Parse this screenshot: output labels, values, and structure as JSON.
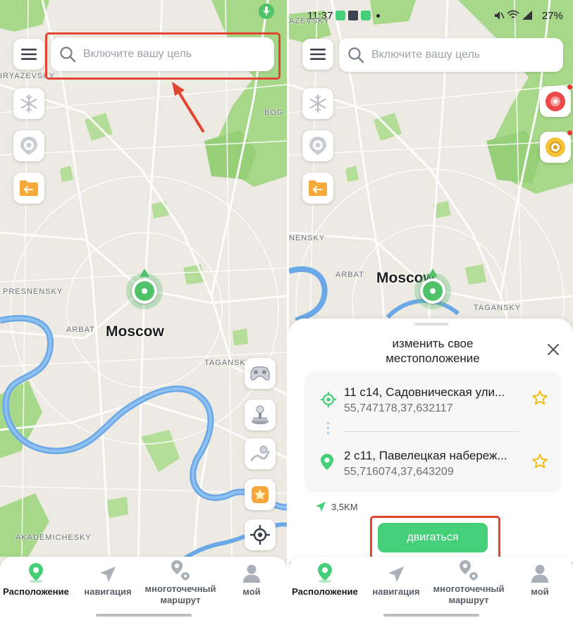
{
  "colors": {
    "accent": "#45cf78",
    "highlight": "#e0452f",
    "map_bg": "#eceae2",
    "park": "#9fd37e",
    "water": "#6aa8e8"
  },
  "left": {
    "search": {
      "placeholder": "Включите вашу цель"
    },
    "map": {
      "city": "Moscow",
      "districts": [
        "IRYAZEVSKY",
        "BOG",
        "PRESNENSKY",
        "ARBAT",
        "TAGANSKY",
        "AKADEMICHESKY"
      ]
    },
    "side_icons": [
      "menu-icon",
      "snowflake-icon",
      "pokeball-icon",
      "folder-import-icon"
    ],
    "right_icons": [
      "gamepad-icon",
      "joystick-icon",
      "route-icon",
      "star-badge-icon",
      "locate-icon"
    ]
  },
  "right": {
    "status_bar": {
      "time": "11:37",
      "battery": "27%"
    },
    "search": {
      "placeholder": "Включите вашу цель"
    },
    "map": {
      "city": "Moscow",
      "districts": [
        "AZEVSKY",
        "NENSKY",
        "ARBAT",
        "TAGANSKY"
      ]
    },
    "sheet": {
      "title": "изменить свое местоположение",
      "from": {
        "address": "11 с14, Садовническая ули...",
        "coords": "55,747178,37,632117"
      },
      "to": {
        "address": "2 с11, Павелецкая набереж...",
        "coords": "55,716074,37,643209"
      },
      "distance": "3,5KM",
      "go_button": "двигаться"
    }
  },
  "nav": {
    "items": [
      {
        "label": "Расположение",
        "icon": "location-pin-icon"
      },
      {
        "label": "навигация",
        "icon": "navigation-arrow-icon"
      },
      {
        "label": "многоточечный маршрут",
        "icon": "multi-point-route-icon"
      },
      {
        "label": "мой",
        "icon": "person-icon"
      }
    ]
  }
}
